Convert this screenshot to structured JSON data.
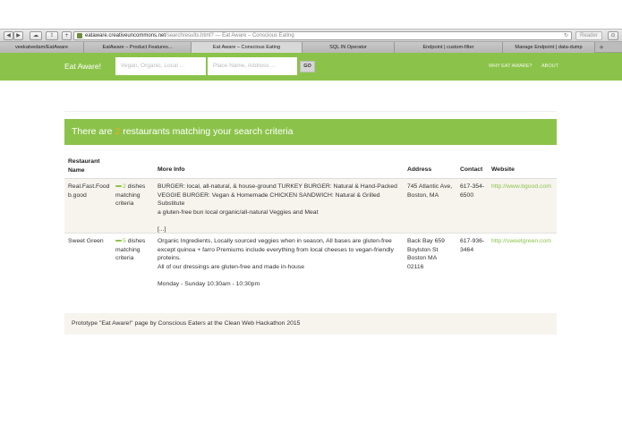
{
  "browser": {
    "url_host": "eataware.creativeuncommons.net",
    "url_rest": "/searchresults.html? — Eat Aware – Conscious Eating",
    "reader_label": "Reader",
    "tabs": [
      "veekatvedam/EatAware",
      "EatAware – Product Features...",
      "Eat Aware – Conscious Eating",
      "SQL IN Operator",
      "Endpoint | custom-filter",
      "Manage Endpoint | data-dump"
    ],
    "new_tab_label": "+"
  },
  "header": {
    "brand": "Eat Aware!",
    "search_placeholder": "Vegan, Organic, Local ...",
    "location_placeholder": "Place Name, Address ...",
    "go_label": "GO",
    "nav": [
      "WHY EAT AWARE?",
      "ABOUT"
    ]
  },
  "banner": {
    "prefix": "There are ",
    "count": "2",
    "suffix": " restaurants matching your search criteria"
  },
  "table": {
    "headers": {
      "restaurant_line1": "Restaurant",
      "restaurant_line2": "Name",
      "more_info": "More Info",
      "address": "Address",
      "contact": "Contact",
      "website": "Website"
    },
    "rows": [
      {
        "name_line1": "Real.Fast.Food",
        "name_line2": "b.good",
        "dish_count": "2",
        "dish_line1": " dishes",
        "dish_line2": "matching",
        "dish_line3": "criteria",
        "info_1": "BURGER: local, all-natural, & house-ground TURKEY BURGER: Natural & Hand-Packed",
        "info_2": "VEGGIE BURGER: Vegan & Homemade CHICKEN SANDWICH: Natural & Grilled Substitute",
        "info_3": "a gluten-free bun local organic/all-natural Veggies and Meat",
        "info_4": "[...]",
        "address_1": "745 Atlantic Ave,",
        "address_2": "Boston, MA",
        "address_3": "",
        "address_4": "",
        "contact_1": "617-354-",
        "contact_2": "6500",
        "website": "http://www.bgood.com"
      },
      {
        "name_line1": "Sweet Green",
        "name_line2": "",
        "dish_count": "5",
        "dish_line1": " dishes",
        "dish_line2": "matching",
        "dish_line3": "criteria",
        "info_1": "Organic Ingredients, Locally sourced veggies when in season, All bases are gluten-free",
        "info_2": "except quinoa + farro Premiums include everything from local cheeses to vegan-friendly",
        "info_3": "proteins.",
        "info_4": "All of our dressings are gluten-free and made in-house",
        "info_5": "Monday - Sunday 10:30am - 10:30pm",
        "address_1": "Back Bay 659",
        "address_2": "Boylston St",
        "address_3": "Boston MA",
        "address_4": "02116",
        "contact_1": "617-936-",
        "contact_2": "3464",
        "website": "http://sweetgreen.com"
      }
    ]
  },
  "footer": {
    "text": "Prototype \"Eat Aware!\" page by Conscious Eaters at the Clean Web Hackathon 2015"
  },
  "colors": {
    "accent": "#8bc34a",
    "count_highlight": "#f2aa1f",
    "row_background": "#f7f4ee"
  },
  "icons": [
    "back-icon",
    "forward-icon",
    "cloud-icon",
    "share-icon",
    "plus-icon",
    "lock-icon",
    "reload-icon",
    "download-icon",
    "dish-bar-icon"
  ]
}
